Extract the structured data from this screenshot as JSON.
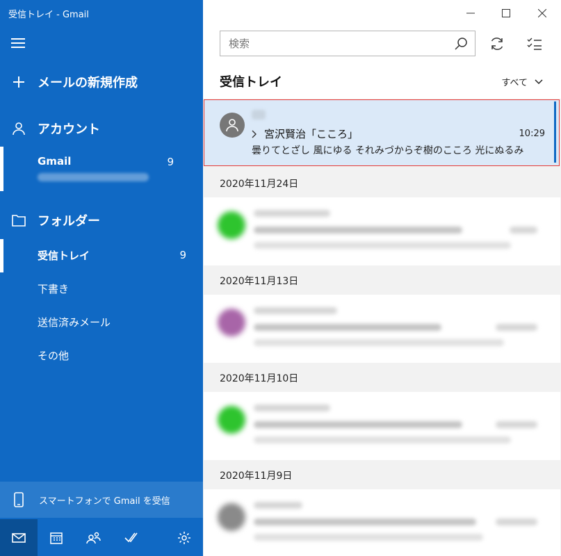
{
  "window": {
    "title": "受信トレイ - Gmail"
  },
  "sidebar": {
    "new_mail": "メールの新規作成",
    "accounts_label": "アカウント",
    "account": {
      "name": "Gmail",
      "count": "9"
    },
    "folders_label": "フォルダー",
    "folders": {
      "inbox": {
        "label": "受信トレイ",
        "count": "9"
      },
      "drafts": "下書き",
      "sent": "送信済みメール",
      "more": "その他"
    },
    "phone_promo": "スマートフォンで Gmail を受信"
  },
  "search": {
    "placeholder": "検索"
  },
  "list": {
    "title": "受信トレイ",
    "filter": "すべて",
    "selected_message": {
      "subject": "宮沢賢治「こころ」",
      "time": "10:29",
      "preview": "曇りてとざし 風にゆる それみづからぞ樹のこころ 光にぬるみ"
    },
    "dates": [
      "2020年11月24日",
      "2020年11月13日",
      "2020年11月10日",
      "2020年11月9日"
    ]
  },
  "colors": {
    "sidebar": "#1069c4",
    "selected_bg": "#dbe9f8",
    "highlight_border": "#e53935",
    "avatar_green": "#2ec42e",
    "avatar_purple": "#a865a8",
    "avatar_gray": "#8a8a8a"
  }
}
